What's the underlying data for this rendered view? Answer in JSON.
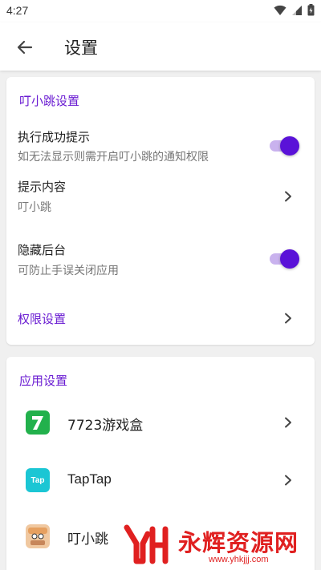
{
  "status": {
    "time": "4:27"
  },
  "header": {
    "title": "设置"
  },
  "section1": {
    "title": "叮小跳设置",
    "items": [
      {
        "title": "执行成功提示",
        "subtitle": "如无法显示则需开启叮小跳的通知权限",
        "type": "toggle",
        "on": true
      },
      {
        "title": "提示内容",
        "subtitle": "叮小跳",
        "type": "chevron"
      },
      {
        "title": "隐藏后台",
        "subtitle": "可防止手误关闭应用",
        "type": "toggle",
        "on": true
      }
    ],
    "link": "权限设置"
  },
  "section2": {
    "title": "应用设置",
    "apps": [
      {
        "name": "7723游戏盒",
        "icon": "7723-app-icon",
        "color": "#22b14c"
      },
      {
        "name": "TapTap",
        "icon": "taptap-app-icon",
        "color": "#1bc6d4",
        "label": "Tap"
      },
      {
        "name": "叮小跳",
        "icon": "dingxiaotiao-app-icon",
        "color": "#f0c8a0"
      }
    ]
  },
  "watermark": {
    "text": "永辉资源网",
    "url": "www.yhkjjj.com"
  },
  "colors": {
    "accent": "#6a1cd2",
    "switch_thumb": "#5a12d8",
    "switch_track": "#c9b2ee"
  }
}
